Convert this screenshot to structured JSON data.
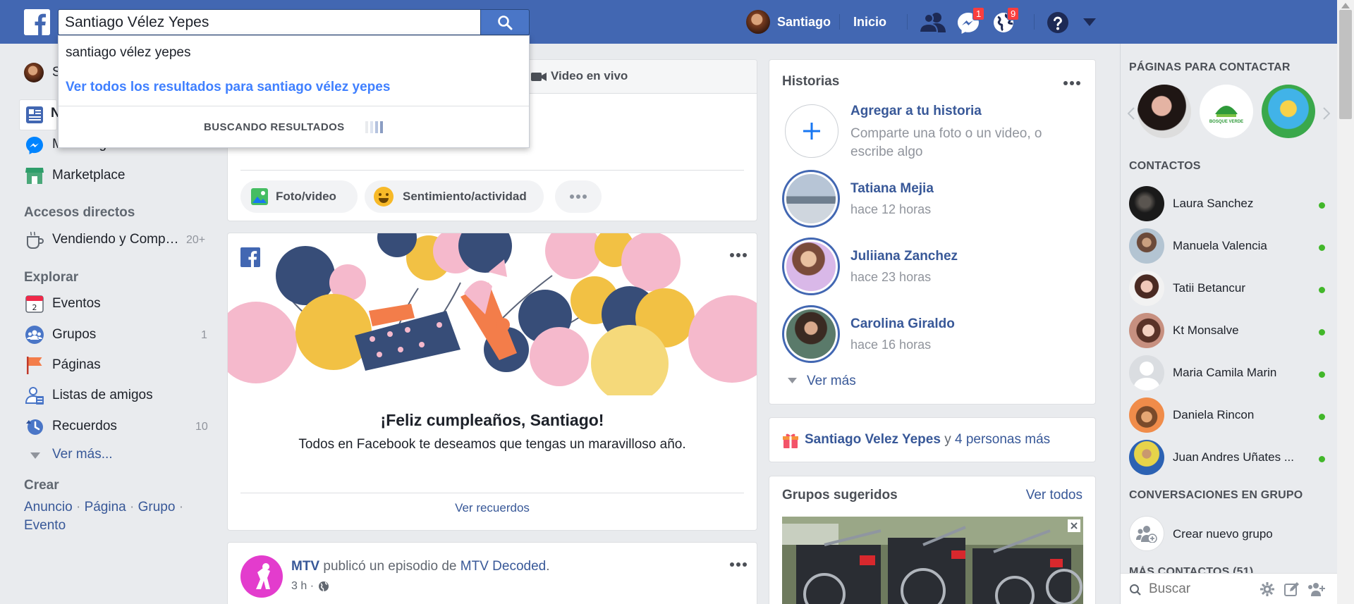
{
  "topbar": {
    "search_value": "Santiago Vélez Yepes",
    "profile_name": "Santiago",
    "home_label": "Inicio",
    "messages_badge": "1",
    "notifications_badge": "9",
    "brand_color": "#4267b2"
  },
  "dropdown": {
    "suggestion": "santiago vélez yepes",
    "see_all": "Ver todos los resultados para santiago vélez yepes",
    "searching": "BUSCANDO RESULTADOS"
  },
  "left": {
    "profile_initial": "S",
    "news_initial": "N",
    "messenger": "Messenger",
    "marketplace": "Marketplace",
    "shortcuts_title": "Accesos directos",
    "shortcut_item": "Vendiendo y Comp…",
    "shortcut_count": "20+",
    "explore_title": "Explorar",
    "explore": [
      {
        "label": "Eventos",
        "count": "",
        "icon": "calendar-icon"
      },
      {
        "label": "Grupos",
        "count": "1",
        "icon": "groups-icon"
      },
      {
        "label": "Páginas",
        "count": "",
        "icon": "flag-icon"
      },
      {
        "label": "Listas de amigos",
        "count": "",
        "icon": "friend-list-icon"
      },
      {
        "label": "Recuerdos",
        "count": "10",
        "icon": "memories-icon"
      }
    ],
    "calendar_day": "2",
    "see_more": "Ver más...",
    "create_title": "Crear",
    "create_links": [
      "Anuncio",
      "Página",
      "Grupo",
      "Evento"
    ],
    "create_separator": "·"
  },
  "composer": {
    "live_video": "Video en vivo",
    "photo_video": "Foto/video",
    "feeling": "Sentimiento/actividad"
  },
  "birthday": {
    "title": "¡Feliz cumpleaños, Santiago!",
    "message": "Todos en Facebook te deseamos que tengas un maravilloso año.",
    "memories_link": "Ver recuerdos"
  },
  "post": {
    "author": "MTV",
    "action": " publicó un episodio de ",
    "target": "MTV Decoded",
    "end": ".",
    "time": "3 h ·"
  },
  "stories": {
    "title": "Historias",
    "add_title": "Agregar a tu historia",
    "add_sub": "Comparte una foto o un video, o escribe algo",
    "items": [
      {
        "name": "Tatiana Mejia",
        "time": "hace 12 horas"
      },
      {
        "name": "Juliiana Zanchez",
        "time": "hace 23 horas"
      },
      {
        "name": "Carolina Giraldo",
        "time": "hace 16 horas"
      }
    ],
    "see_more": "Ver más"
  },
  "birthdays_widget": {
    "name": "Santiago Velez Yepes",
    "and": " y ",
    "others": "4 personas más"
  },
  "groups": {
    "title": "Grupos sugeridos",
    "see_all": "Ver todos"
  },
  "rightbar": {
    "pages_title": "PÁGINAS PARA CONTACTAR",
    "bosque_label": "BOSQUE VERDE",
    "contacts_title": "CONTACTOS",
    "contacts": [
      "Laura Sanchez",
      "Manuela Valencia",
      "Tatii Betancur",
      "Kt Monsalve",
      "Maria Camila Marin",
      "Daniela Rincon",
      "Juan Andres Uñates ..."
    ],
    "group_conv_title": "CONVERSACIONES EN GRUPO",
    "new_group": "Crear nuevo grupo",
    "more_contacts": "MÁS CONTACTOS (51)",
    "search_placeholder": "Buscar",
    "online_color": "#42b72a"
  }
}
